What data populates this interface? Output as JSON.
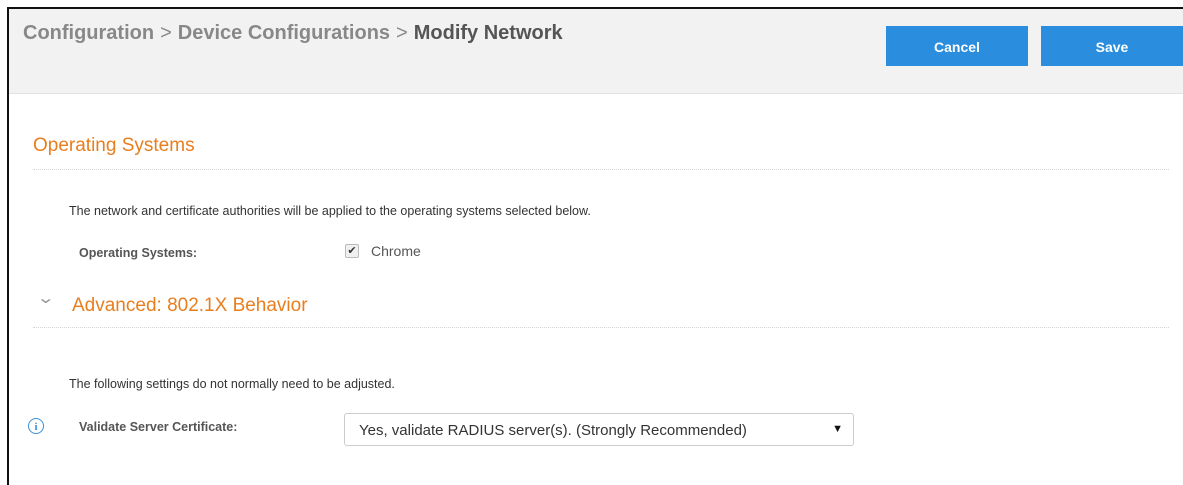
{
  "header": {
    "breadcrumb": [
      "Configuration",
      "Device Configurations",
      "Modify Network"
    ],
    "separator": ">",
    "cancel_label": "Cancel",
    "save_label": "Save"
  },
  "operating_systems": {
    "title": "Operating Systems",
    "description": "The network and certificate authorities will be applied to the operating systems selected below.",
    "field_label": "Operating Systems:",
    "option_label": "Chrome",
    "option_checked": true
  },
  "advanced": {
    "title": "Advanced: 802.1X Behavior",
    "expanded": true,
    "chevron_icon": "chevron-down-icon",
    "description": "The following settings do not normally need to be adjusted.",
    "validate_label": "Validate Server Certificate:",
    "validate_value": "Yes, validate RADIUS server(s). (Strongly Recommended)",
    "info_icon": "info-icon"
  },
  "colors": {
    "accent_orange": "#e87e1e",
    "button_blue": "#2a8ddd",
    "header_bg": "#f2f2f2",
    "info_blue": "#3a8fd5"
  }
}
